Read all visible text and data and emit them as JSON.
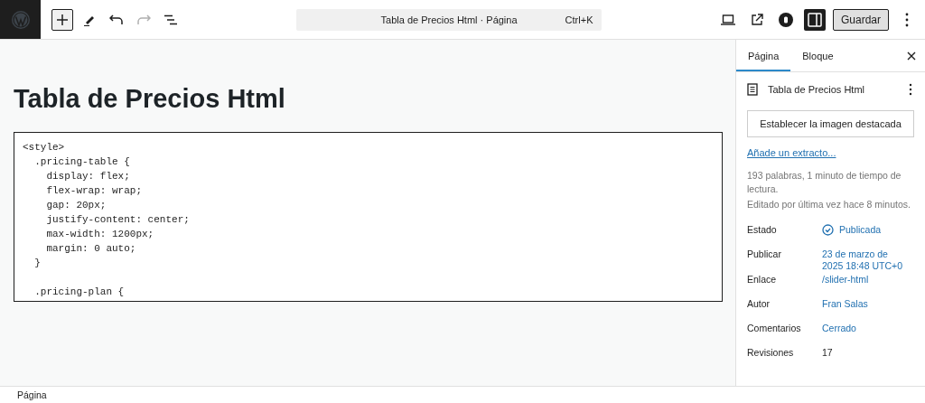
{
  "toolbar": {
    "inserter_selected": true,
    "document_title": "Tabla de Precios Html · Página",
    "shortcut": "Ctrl+K",
    "settings_selected": true,
    "save_button": "Guardar"
  },
  "editor": {
    "title": "Tabla de Precios Html",
    "code": "<style>\n  .pricing-table {\n    display: flex;\n    flex-wrap: wrap;\n    gap: 20px;\n    justify-content: center;\n    max-width: 1200px;\n    margin: 0 auto;\n  }\n\n  .pricing-plan {"
  },
  "sidebar": {
    "tabs": [
      {
        "label": "Página",
        "selected": true
      },
      {
        "label": "Bloque",
        "selected": false
      }
    ],
    "page_title": "Tabla de Precios Html",
    "featured_image_button": "Establecer la imagen destacada",
    "excerpt_link": "Añade un extracto...",
    "stats": "193 palabras, 1 minuto de tiempo de lectura.",
    "last_edited": "Editado por última vez hace 8 minutos.",
    "fields": [
      {
        "label": "Estado",
        "value": "Publicada",
        "kind": "status"
      },
      {
        "label": "Publicar",
        "value": "23 de marzo de 2025 18:48 UTC+0",
        "kind": "link"
      },
      {
        "label": "Enlace",
        "value": "/slider-html",
        "kind": "link"
      },
      {
        "label": "Autor",
        "value": "Fran Salas",
        "kind": "link"
      },
      {
        "label": "Comentarios",
        "value": "Cerrado",
        "kind": "link"
      },
      {
        "label": "Revisiones",
        "value": "17",
        "kind": "text"
      }
    ]
  },
  "status_bar": {
    "breadcrumb": "Página"
  }
}
